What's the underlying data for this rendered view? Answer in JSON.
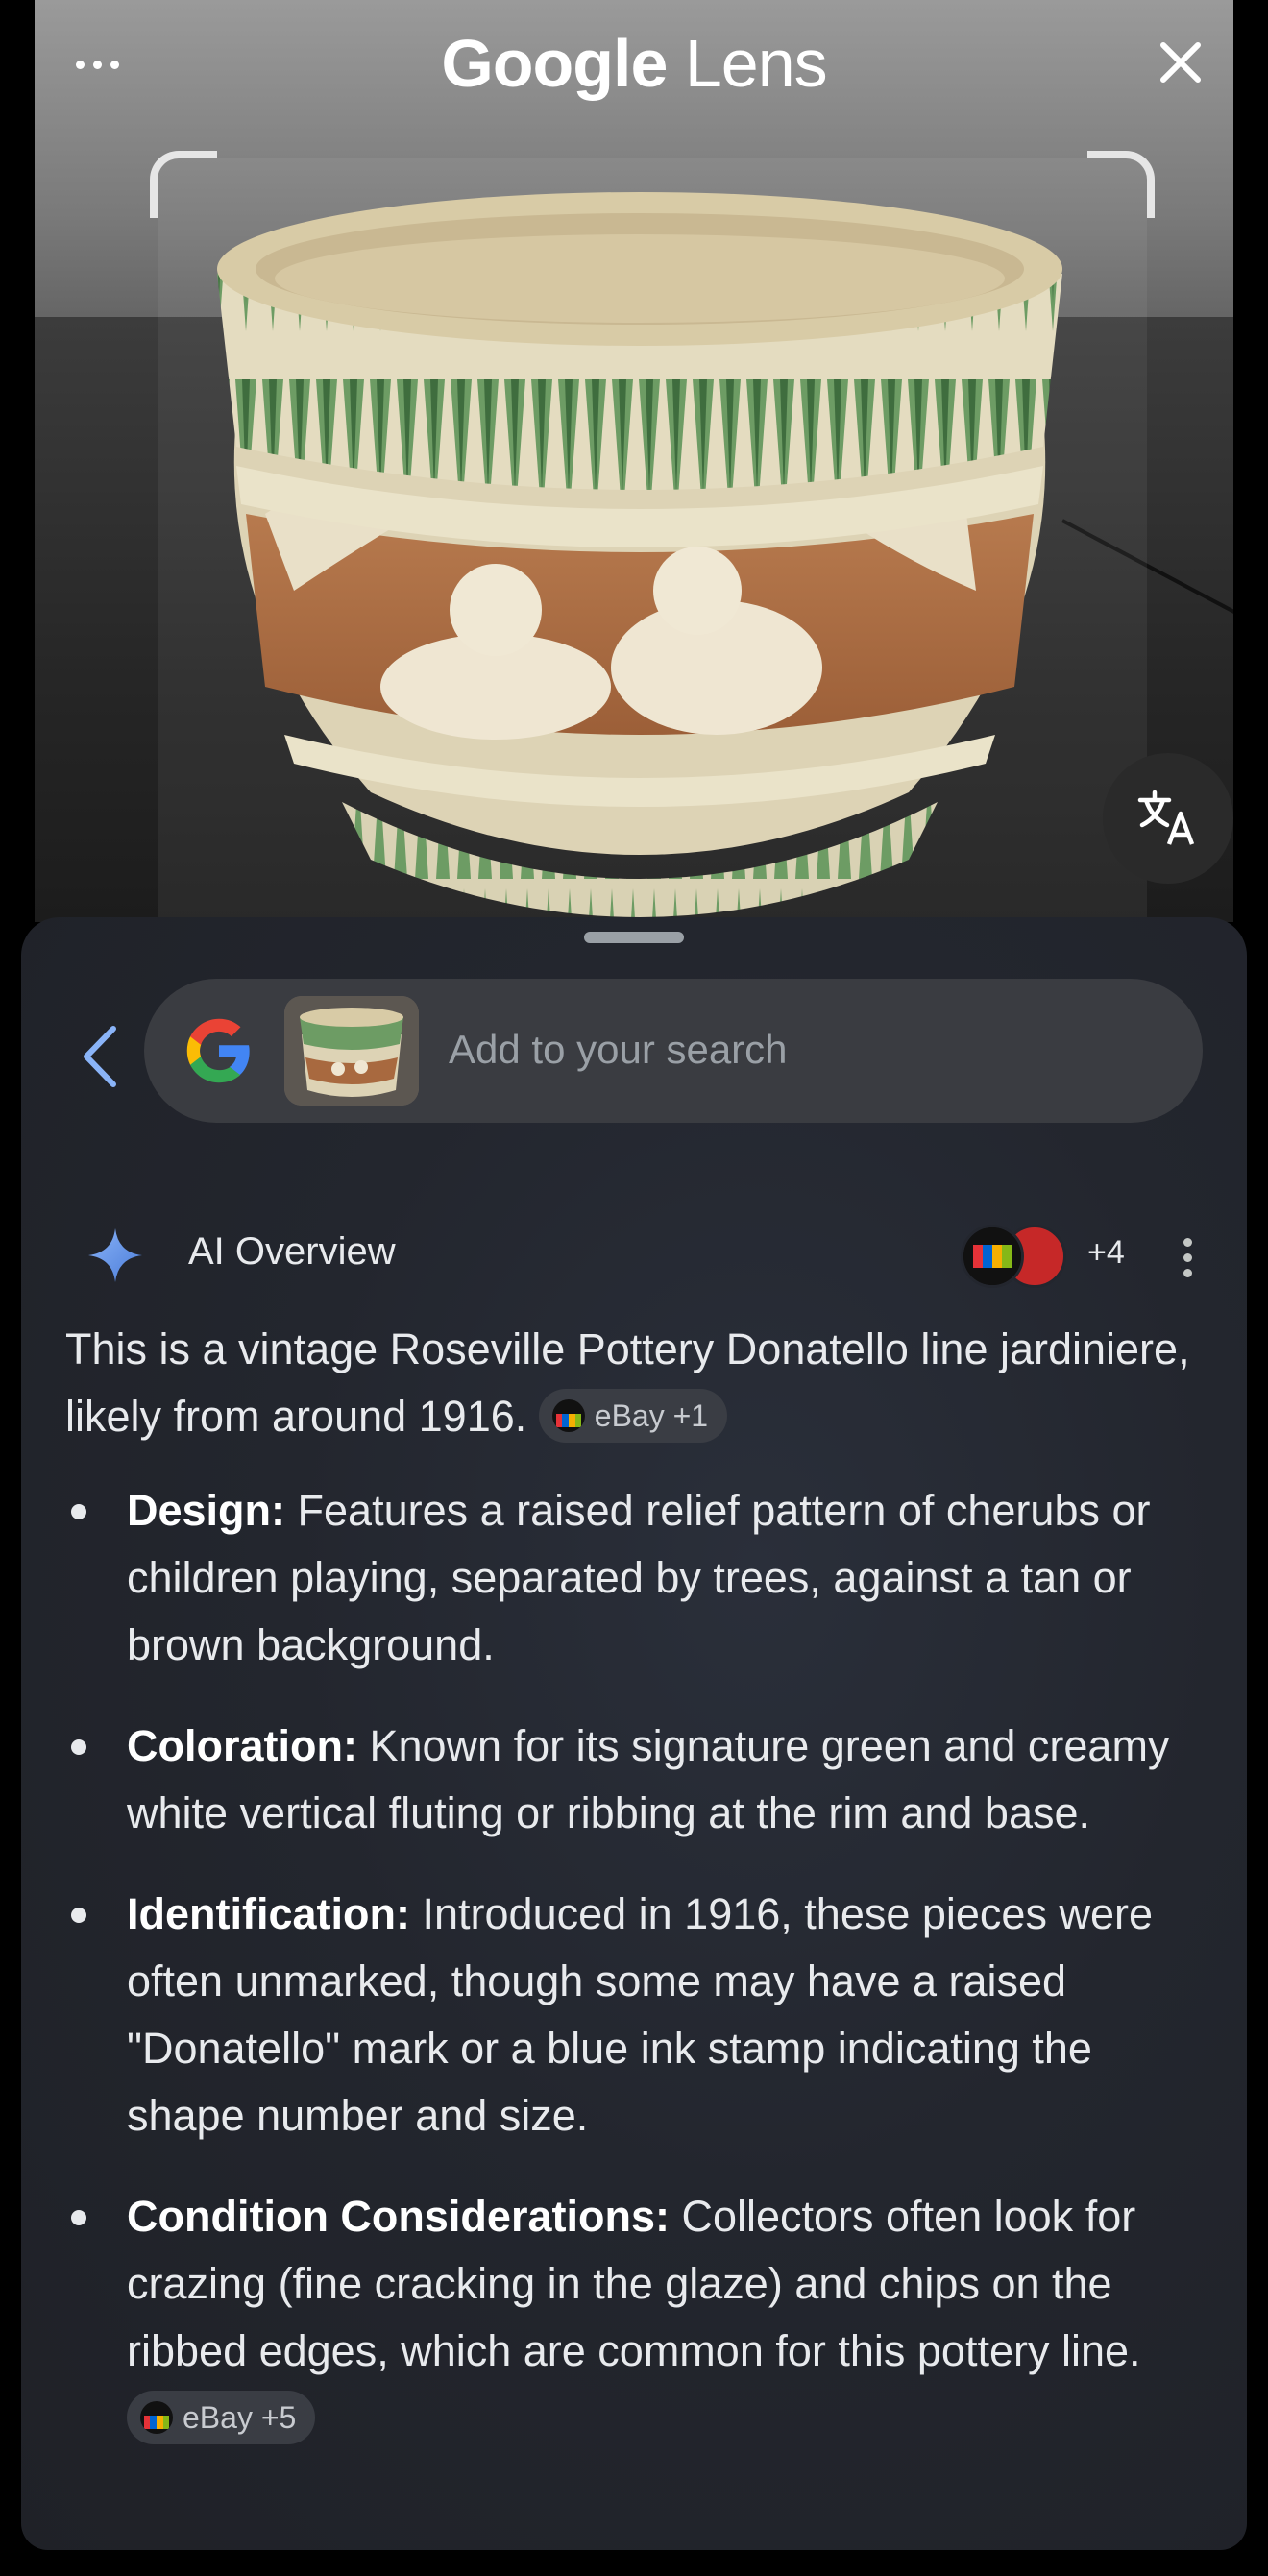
{
  "header": {
    "title_brand": "Google",
    "title_product": "Lens"
  },
  "search": {
    "placeholder": "Add to your search"
  },
  "ai_overview": {
    "title": "AI Overview",
    "sources_more": "+4",
    "intro": "This is a vintage Roseville Pottery Donatello line jardiniere, likely from around 1916.",
    "intro_chip": "eBay +1",
    "bullets": [
      {
        "label": "Design:",
        "text": "Features a raised relief pattern of cherubs or children playing, separated by trees, against a tan or brown background."
      },
      {
        "label": "Coloration:",
        "text": "Known for its signature green and creamy white vertical fluting or ribbing at the rim and base."
      },
      {
        "label": "Identification:",
        "text": "Introduced in 1916, these pieces were often unmarked, though some may have a raised \"Donatello\" mark or a blue ink stamp indicating the shape number and size."
      },
      {
        "label": "Condition Considerations:",
        "text": "Collectors often look for crazing (fine cracking in the glaze) and chips on the ribbed edges, which are common for this pottery line.",
        "chip": "eBay +5"
      }
    ]
  },
  "icons": [
    "more-icon",
    "close-icon",
    "translate-icon",
    "back-icon",
    "google-logo-icon",
    "sparkle-icon",
    "kebab-icon",
    "ebay-icon"
  ],
  "colors": {
    "accent_blue": "#8ab4f8",
    "sheet_bg": "#23262e",
    "pill_bg": "#3a3c41"
  }
}
